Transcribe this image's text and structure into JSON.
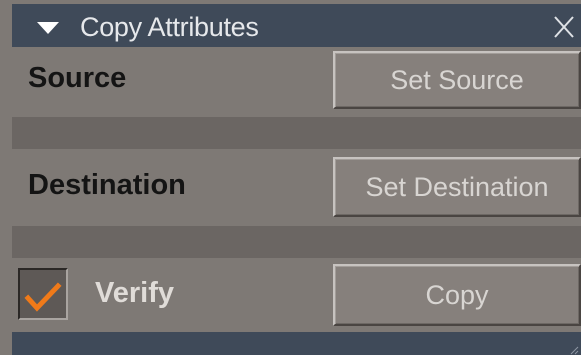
{
  "panel": {
    "title": "Copy Attributes",
    "collapse_icon": "triangle-down-icon",
    "close_icon": "close-icon"
  },
  "source": {
    "label": "Source",
    "button_label": "Set Source"
  },
  "destination": {
    "label": "Destination",
    "button_label": "Set Destination"
  },
  "verify": {
    "label": "Verify",
    "checked": true,
    "check_color": "#f07a19"
  },
  "copy": {
    "button_label": "Copy"
  },
  "colors": {
    "titlebar": "#3f4a59",
    "panel": "#7e7975",
    "accent": "#f07a19"
  }
}
